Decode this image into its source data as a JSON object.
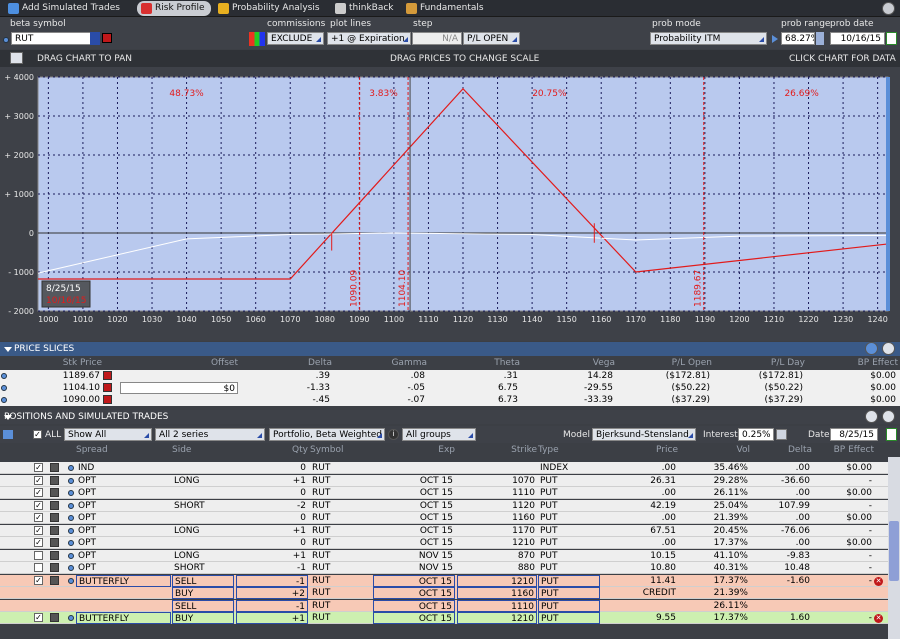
{
  "toolbar": {
    "tabs": [
      {
        "label": "Add Simulated Trades",
        "icon": "plus-icon"
      },
      {
        "label": "Risk Profile",
        "icon": "chart-icon"
      },
      {
        "label": "Probability Analysis",
        "icon": "probability-icon"
      },
      {
        "label": "thinkBack",
        "icon": "rewind-icon"
      },
      {
        "label": "Fundamentals",
        "icon": "briefcase-icon"
      }
    ]
  },
  "header": {
    "beta_symbol_label": "beta symbol",
    "beta_symbol_value": "RUT",
    "commissions_label": "commissions",
    "commissions_value": "EXCLUDE",
    "plot_lines_label": "plot lines",
    "plot_lines_value": "+1 @ Expiration",
    "step_label": "step",
    "step_value": "N/A",
    "pl_open": "P/L OPEN",
    "prob_mode_label": "prob mode",
    "prob_mode_value": "Probability ITM",
    "prob_range_label": "prob range",
    "prob_range_value": "68.27%",
    "prob_date_label": "prob date",
    "prob_date_value": "10/16/15"
  },
  "chartbar": {
    "pan": "DRAG CHART TO PAN",
    "scale": "DRAG PRICES TO CHANGE SCALE",
    "click": "CLICK CHART FOR DATA"
  },
  "chart_data": {
    "type": "line",
    "xlim": [
      997,
      1243
    ],
    "ylim": [
      -2000,
      4000
    ],
    "x_ticks": [
      1000,
      1010,
      1020,
      1030,
      1040,
      1050,
      1060,
      1070,
      1080,
      1090,
      1100,
      1110,
      1120,
      1130,
      1140,
      1150,
      1160,
      1170,
      1180,
      1190,
      1200,
      1210,
      1220,
      1230,
      1240
    ],
    "y_ticks": [
      {
        "v": 4000,
        "label": "+ 4000"
      },
      {
        "v": 3000,
        "label": "+ 3000"
      },
      {
        "v": 2000,
        "label": "+ 2000"
      },
      {
        "v": 1000,
        "label": "+ 1000"
      },
      {
        "v": 0,
        "label": "0"
      },
      {
        "v": -1000,
        "label": "- 1000"
      },
      {
        "v": -2000,
        "label": "- 2000"
      }
    ],
    "grid": true,
    "series": [
      {
        "points": [
          [
            997,
            -1180
          ],
          [
            1070,
            -1180
          ],
          [
            1120,
            3700
          ],
          [
            1170,
            -1000
          ],
          [
            1243,
            -280
          ]
        ],
        "color": "#e21b1b"
      },
      {
        "points": [
          [
            997,
            -1030
          ],
          [
            1040,
            -150
          ],
          [
            1070,
            -40
          ],
          [
            1100,
            0
          ],
          [
            1140,
            -40
          ],
          [
            1170,
            -180
          ],
          [
            1200,
            -80
          ],
          [
            1243,
            -60
          ]
        ],
        "color": "#ffffff"
      }
    ],
    "vlines": [
      {
        "x": 1090.09,
        "label": "1090.09"
      },
      {
        "x": 1104.1,
        "label": "1104.10"
      },
      {
        "x": 1189.67,
        "label": "1189.67"
      }
    ],
    "current_price": 1104.1,
    "prob_labels": [
      {
        "x": 1040,
        "label": "48.73%"
      },
      {
        "x": 1097,
        "label": "3.83%"
      },
      {
        "x": 1145,
        "label": "20.75%"
      },
      {
        "x": 1218,
        "label": "26.69%"
      }
    ],
    "date_badge": [
      "8/25/15",
      "10/16/15"
    ]
  },
  "price_slices": {
    "title": "PRICE SLICES",
    "columns": [
      "Stk Price",
      "Offset",
      "Delta",
      "Gamma",
      "Theta",
      "Vega",
      "P/L Open",
      "P/L Day",
      "BP Effect"
    ],
    "rows": [
      {
        "stk": "1189.67",
        "offset": "",
        "delta": ".39",
        "gamma": ".08",
        "theta": ".31",
        "vega": "14.28",
        "plopen": "($172.81)",
        "plday": "($172.81)",
        "bp": "$0.00"
      },
      {
        "stk": "1104.10",
        "offset": "$0",
        "delta": "-1.33",
        "gamma": "-.05",
        "theta": "6.75",
        "vega": "-29.55",
        "plopen": "($50.22)",
        "plday": "($50.22)",
        "bp": "$0.00"
      },
      {
        "stk": "1090.00",
        "offset": "",
        "delta": "-.45",
        "gamma": "-.07",
        "theta": "6.73",
        "vega": "-33.39",
        "plopen": "($37.29)",
        "plday": "($37.29)",
        "bp": "$0.00"
      }
    ]
  },
  "positions": {
    "title": "POSITIONS AND SIMULATED TRADES",
    "all_label": "ALL",
    "show": "Show All",
    "series": "All 2 series",
    "portfolio": "Portfolio, Beta Weighted",
    "groups": "All groups",
    "model_label": "Model",
    "model": "Bjerksund-Stensland",
    "interest_label": "Interest",
    "interest": "0.25%",
    "date_label": "Date",
    "date": "8/25/15",
    "columns": [
      "Spread",
      "Side",
      "Qty",
      "Symbol",
      "Exp",
      "Strike",
      "Type",
      "Price",
      "Vol",
      "Delta",
      "BP Effect"
    ],
    "rows": [
      {
        "spread": "IND",
        "side": "",
        "qty": "0",
        "sym": "RUT",
        "exp": "",
        "strike": "",
        "type": "INDEX",
        "price": ".00",
        "vol": "35.46%",
        "delta": ".00",
        "bp": "$0.00",
        "style": "plain",
        "chk": true
      },
      {
        "spread": "OPT",
        "side": "LONG",
        "qty": "+1",
        "sym": "RUT",
        "exp": "OCT 15",
        "strike": "1070",
        "type": "PUT",
        "price": "26.31",
        "vol": "29.28%",
        "delta": "-36.60",
        "bp": "-",
        "style": "plain",
        "chk": true
      },
      {
        "spread": "OPT",
        "side": "",
        "qty": "0",
        "sym": "RUT",
        "exp": "OCT 15",
        "strike": "1110",
        "type": "PUT",
        "price": ".00",
        "vol": "26.11%",
        "delta": ".00",
        "bp": "$0.00",
        "style": "plain",
        "chk": true
      },
      {
        "spread": "OPT",
        "side": "SHORT",
        "qty": "-2",
        "sym": "RUT",
        "exp": "OCT 15",
        "strike": "1120",
        "type": "PUT",
        "price": "42.19",
        "vol": "25.04%",
        "delta": "107.99",
        "bp": "-",
        "style": "plain",
        "chk": true
      },
      {
        "spread": "OPT",
        "side": "",
        "qty": "0",
        "sym": "RUT",
        "exp": "OCT 15",
        "strike": "1160",
        "type": "PUT",
        "price": ".00",
        "vol": "21.39%",
        "delta": ".00",
        "bp": "$0.00",
        "style": "plain",
        "chk": true
      },
      {
        "spread": "OPT",
        "side": "LONG",
        "qty": "+1",
        "sym": "RUT",
        "exp": "OCT 15",
        "strike": "1170",
        "type": "PUT",
        "price": "67.51",
        "vol": "20.45%",
        "delta": "-76.06",
        "bp": "-",
        "style": "plain",
        "chk": true
      },
      {
        "spread": "OPT",
        "side": "",
        "qty": "0",
        "sym": "RUT",
        "exp": "OCT 15",
        "strike": "1210",
        "type": "PUT",
        "price": ".00",
        "vol": "17.37%",
        "delta": ".00",
        "bp": "$0.00",
        "style": "plain",
        "chk": true
      },
      {
        "spread": "OPT",
        "side": "LONG",
        "qty": "+1",
        "sym": "RUT",
        "exp": "NOV 15",
        "strike": "870",
        "type": "PUT",
        "price": "10.15",
        "vol": "41.10%",
        "delta": "-9.83",
        "bp": "-",
        "style": "plain",
        "chk": false
      },
      {
        "spread": "OPT",
        "side": "SHORT",
        "qty": "-1",
        "sym": "RUT",
        "exp": "NOV 15",
        "strike": "880",
        "type": "PUT",
        "price": "10.80",
        "vol": "40.31%",
        "delta": "10.48",
        "bp": "-",
        "style": "plain",
        "chk": false
      },
      {
        "spread": "BUTTERFLY",
        "side": "SELL",
        "qty": "-1",
        "sym": "RUT",
        "exp": "OCT 15",
        "strike": "1210",
        "type": "PUT",
        "price": "11.41",
        "vol": "17.37%",
        "delta": "-1.60",
        "bp": "-",
        "style": "sell",
        "chk": true
      },
      {
        "spread": "",
        "side": "BUY",
        "qty": "+2",
        "sym": "RUT",
        "exp": "OCT 15",
        "strike": "1160",
        "type": "PUT",
        "price": "CREDIT",
        "vol": "21.39%",
        "delta": "",
        "bp": "",
        "style": "sell-sub",
        "chk": false
      },
      {
        "spread": "",
        "side": "SELL",
        "qty": "-1",
        "sym": "RUT",
        "exp": "OCT 15",
        "strike": "1110",
        "type": "PUT",
        "price": "",
        "vol": "26.11%",
        "delta": "",
        "bp": "",
        "style": "sell-sub",
        "chk": false
      },
      {
        "spread": "BUTTERFLY",
        "side": "BUY",
        "qty": "+1",
        "sym": "RUT",
        "exp": "OCT 15",
        "strike": "1210",
        "type": "PUT",
        "price": "9.55",
        "vol": "17.37%",
        "delta": "1.60",
        "bp": "-",
        "style": "buy",
        "chk": true
      }
    ]
  }
}
